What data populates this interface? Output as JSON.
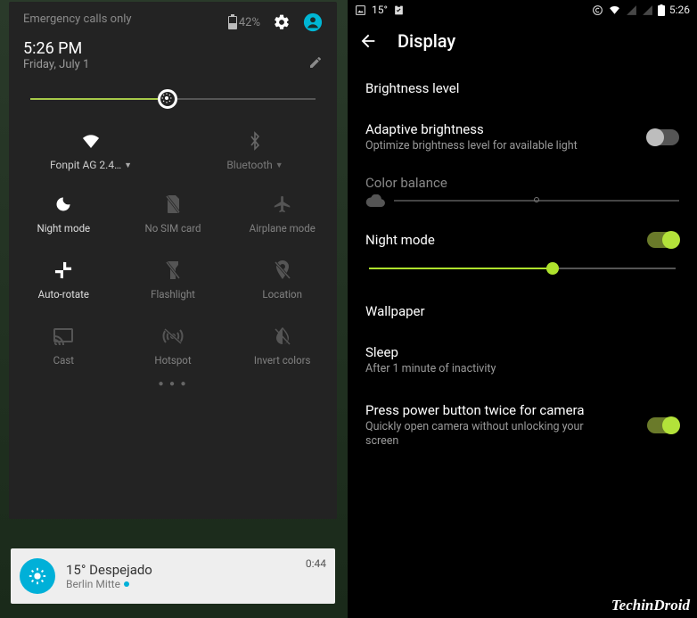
{
  "left": {
    "status_text": "Emergency calls only",
    "battery_pct": "42%",
    "time": "5:26 PM",
    "date": "Friday, July 1",
    "brightness_pct": 48,
    "wifi": {
      "label": "Fonpit AG 2.4…"
    },
    "bluetooth": {
      "label": "Bluetooth"
    },
    "tiles_row2": [
      {
        "label": "Night mode"
      },
      {
        "label": "No SIM card"
      },
      {
        "label": "Airplane mode"
      }
    ],
    "tiles_row3": [
      {
        "label": "Auto-rotate"
      },
      {
        "label": "Flashlight"
      },
      {
        "label": "Location"
      }
    ],
    "tiles_row4": [
      {
        "label": "Cast"
      },
      {
        "label": "Hotspot"
      },
      {
        "label": "Invert colors"
      }
    ],
    "notification": {
      "title": "15° Despejado",
      "place": "Berlin Mitte",
      "time": "0:44"
    }
  },
  "right": {
    "status": {
      "temp": "15°",
      "clock": "5:26"
    },
    "appbar_title": "Display",
    "settings": {
      "brightness_level": "Brightness level",
      "adaptive": {
        "title": "Adaptive brightness",
        "sub": "Optimize brightness level for available light",
        "on": false
      },
      "color_balance": "Color balance",
      "night_mode": {
        "title": "Night mode",
        "on": true,
        "slider_pct": 60
      },
      "wallpaper": "Wallpaper",
      "sleep": {
        "title": "Sleep",
        "sub": "After 1 minute of inactivity"
      },
      "power_cam": {
        "title": "Press power button twice for camera",
        "sub": "Quickly open camera without unlocking your screen",
        "on": true
      }
    }
  },
  "watermark": "TechinDroid"
}
